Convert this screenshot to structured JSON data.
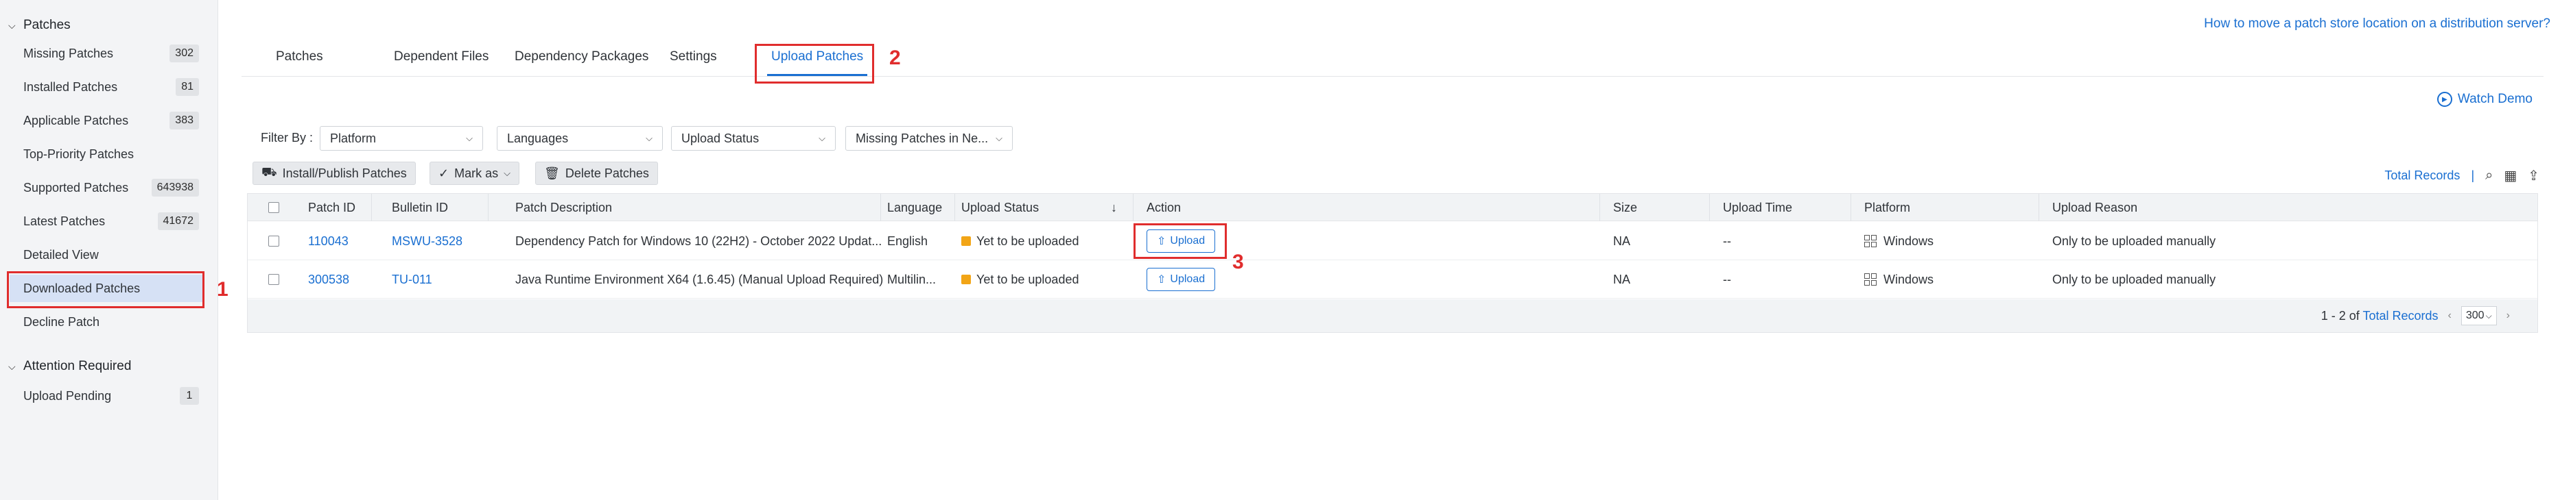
{
  "sidebar": {
    "patches_header": "Patches",
    "items": [
      {
        "label": "Missing Patches",
        "count": "302"
      },
      {
        "label": "Installed Patches",
        "count": "81"
      },
      {
        "label": "Applicable Patches",
        "count": "383"
      },
      {
        "label": "Top-Priority Patches",
        "count": ""
      },
      {
        "label": "Supported Patches",
        "count": "643938"
      },
      {
        "label": "Latest Patches",
        "count": "41672"
      },
      {
        "label": "Detailed View",
        "count": ""
      },
      {
        "label": "Downloaded Patches",
        "count": ""
      },
      {
        "label": "Decline Patch",
        "count": ""
      }
    ],
    "attention_header": "Attention Required",
    "attention_items": [
      {
        "label": "Upload Pending",
        "count": "1"
      }
    ]
  },
  "help_link": "How to move a patch store location on a distribution server?",
  "tabs": [
    "Patches",
    "Dependent Files",
    "Dependency Packages",
    "Settings",
    "Upload Patches"
  ],
  "active_tab": "Upload Patches",
  "watch_demo": "Watch Demo",
  "filters": {
    "label": "Filter By :",
    "platform": "Platform",
    "languages": "Languages",
    "upload_status": "Upload Status",
    "missing_patches": "Missing Patches in Ne..."
  },
  "toolbar": {
    "install_publish": "Install/Publish Patches",
    "mark_as": "Mark as",
    "delete": "Delete Patches",
    "total_records": "Total Records",
    "sep": "|"
  },
  "table": {
    "headers": [
      "Patch ID",
      "Bulletin ID",
      "Patch Description",
      "Language",
      "Upload Status",
      "Action",
      "Size",
      "Upload Time",
      "Platform",
      "Upload Reason"
    ],
    "rows": [
      {
        "patch_id": "110043",
        "bulletin_id": "MSWU-3528",
        "description": "Dependency Patch for Windows 10 (22H2) - October 2022 Updat...",
        "language": "English",
        "status": "Yet to be uploaded",
        "action": "Upload",
        "size": "NA",
        "upload_time": "--",
        "platform": "Windows",
        "reason": "Only to be uploaded manually"
      },
      {
        "patch_id": "300538",
        "bulletin_id": "TU-011",
        "description": "Java Runtime Environment X64 (1.6.45) (Manual Upload Required)",
        "language": "Multilin...",
        "status": "Yet to be uploaded",
        "action": "Upload",
        "size": "NA",
        "upload_time": "--",
        "platform": "Windows",
        "reason": "Only to be uploaded manually"
      }
    ]
  },
  "pager": {
    "range": "1 - 2 of",
    "total_records": "Total Records",
    "per_page": "300"
  },
  "callouts": [
    "1",
    "2",
    "3"
  ],
  "colors": {
    "accent": "#1a6fd1",
    "callout": "#e02d2d",
    "warning": "#f2a516"
  }
}
